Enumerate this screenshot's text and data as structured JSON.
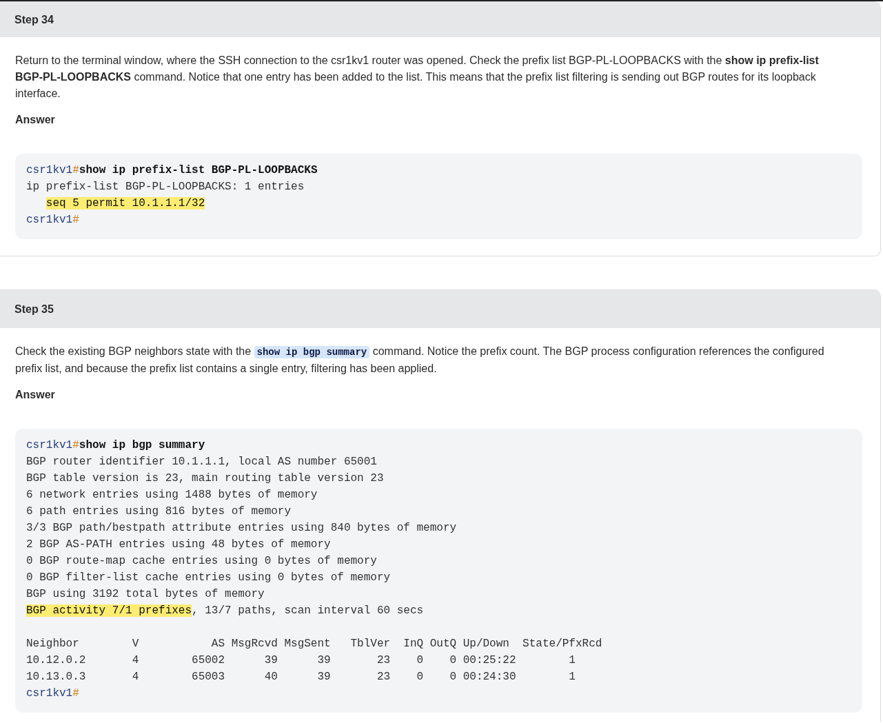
{
  "steps": [
    {
      "title": "Step 34",
      "paragraph": [
        {
          "kind": "text",
          "text": "Return to the terminal window, where the SSH connection to the csr1kv1 router was opened. Check the prefix list BGP-PL-LOOPBACKS with the "
        },
        {
          "kind": "bold",
          "text": "show ip prefix-list BGP-PL-LOOPBACKS"
        },
        {
          "kind": "text",
          "text": " command. Notice that one entry has been added to the list. This means that the prefix list filtering is sending out BGP routes for its loopback interface."
        }
      ],
      "answer_label": "Answer",
      "code": [
        {
          "segments": [
            {
              "kind": "prompt",
              "text": "csr1kv1"
            },
            {
              "kind": "hash",
              "text": "#"
            },
            {
              "kind": "command",
              "text": "show ip prefix-list BGP-PL-LOOPBACKS"
            }
          ]
        },
        {
          "segments": [
            {
              "kind": "output",
              "text": "ip prefix-list BGP-PL-LOOPBACKS: 1 entries"
            }
          ]
        },
        {
          "indented": true,
          "segments": [
            {
              "kind": "highlight",
              "text": "seq 5 permit 10.1.1.1/32"
            }
          ]
        },
        {
          "segments": [
            {
              "kind": "prompt",
              "text": "csr1kv1"
            },
            {
              "kind": "hash",
              "text": "#"
            }
          ]
        }
      ]
    },
    {
      "title": "Step 35",
      "paragraph": [
        {
          "kind": "text",
          "text": "Check the existing BGP neighbors state with the "
        },
        {
          "kind": "code",
          "text": "show ip bgp summary"
        },
        {
          "kind": "text",
          "text": " command. Notice the prefix count. The BGP process configuration references the configured prefix list, and because the prefix list contains a single entry, filtering has been applied."
        }
      ],
      "answer_label": "Answer",
      "code": [
        {
          "segments": [
            {
              "kind": "prompt",
              "text": "csr1kv1"
            },
            {
              "kind": "hash",
              "text": "#"
            },
            {
              "kind": "command",
              "text": "show ip bgp summary"
            }
          ]
        },
        {
          "segments": [
            {
              "kind": "output",
              "text": "BGP router identifier 10.1.1.1, local AS number 65001"
            }
          ]
        },
        {
          "segments": [
            {
              "kind": "output",
              "text": "BGP table version is 23, main routing table version 23"
            }
          ]
        },
        {
          "segments": [
            {
              "kind": "output",
              "text": "6 network entries using 1488 bytes of memory"
            }
          ]
        },
        {
          "segments": [
            {
              "kind": "output",
              "text": "6 path entries using 816 bytes of memory"
            }
          ]
        },
        {
          "segments": [
            {
              "kind": "output",
              "text": "3/3 BGP path/bestpath attribute entries using 840 bytes of memory"
            }
          ]
        },
        {
          "segments": [
            {
              "kind": "output",
              "text": "2 BGP AS-PATH entries using 48 bytes of memory"
            }
          ]
        },
        {
          "segments": [
            {
              "kind": "output",
              "text": "0 BGP route-map cache entries using 0 bytes of memory"
            }
          ]
        },
        {
          "segments": [
            {
              "kind": "output",
              "text": "0 BGP filter-list cache entries using 0 bytes of memory"
            }
          ]
        },
        {
          "segments": [
            {
              "kind": "output",
              "text": "BGP using 3192 total bytes of memory"
            }
          ]
        },
        {
          "segments": [
            {
              "kind": "highlight",
              "text": "BGP activity 7/1 prefixes"
            },
            {
              "kind": "output",
              "text": ", 13/7 paths, scan interval 60 secs"
            }
          ]
        },
        {
          "gap_before": true,
          "segments": [
            {
              "kind": "output",
              "text": "Neighbor        V           AS MsgRcvd MsgSent   TblVer  InQ OutQ Up/Down  State/PfxRcd"
            }
          ]
        },
        {
          "segments": [
            {
              "kind": "output",
              "text": "10.12.0.2       4        65002      39      39       23    0    0 00:25:22        1"
            }
          ]
        },
        {
          "segments": [
            {
              "kind": "output",
              "text": "10.13.0.3       4        65003      40      39       23    0    0 00:24:30        1"
            }
          ]
        },
        {
          "segments": [
            {
              "kind": "prompt",
              "text": "csr1kv1"
            },
            {
              "kind": "hash",
              "text": "#"
            }
          ]
        }
      ]
    }
  ]
}
